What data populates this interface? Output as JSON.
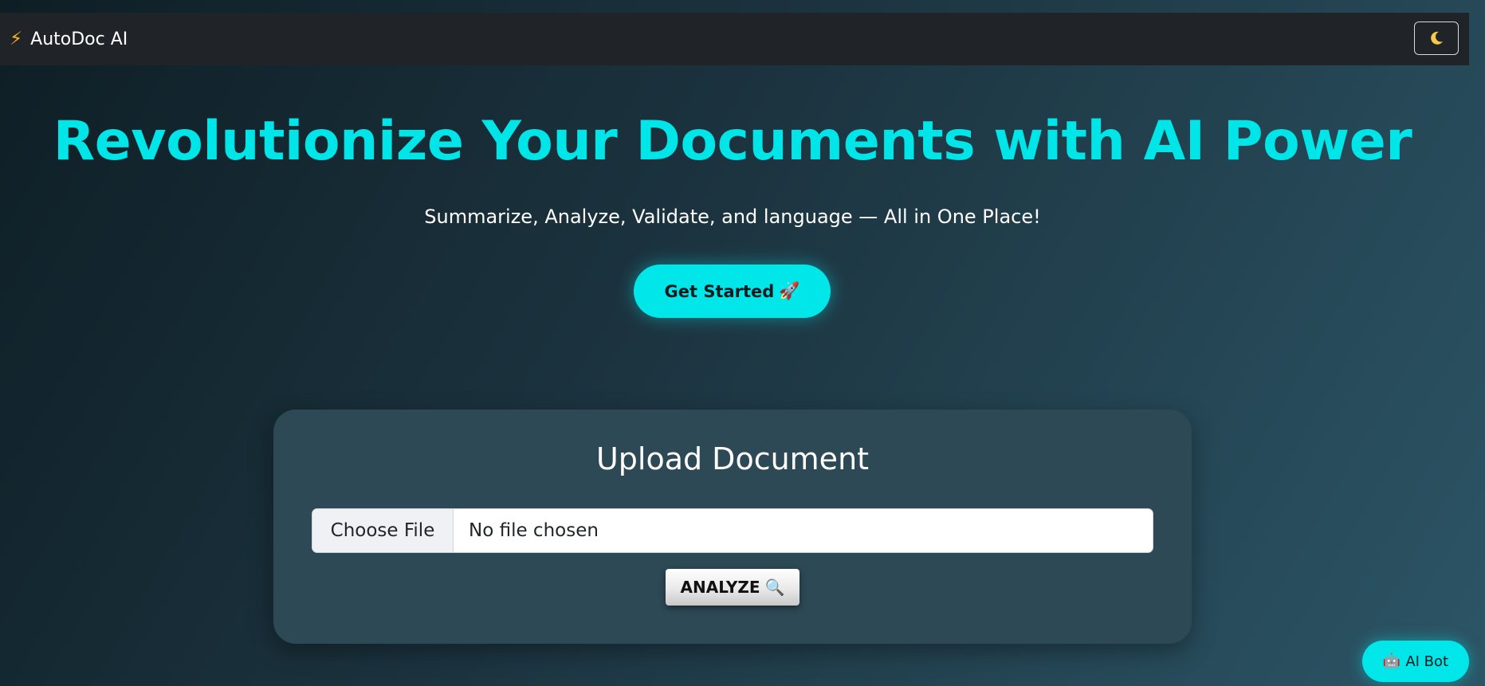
{
  "navbar": {
    "brand_icon": "lightning-icon",
    "brand_name": "AutoDoc AI",
    "theme_toggle_icon": "moon-icon"
  },
  "hero": {
    "title": "Revolutionize Your Documents with AI Power",
    "subtitle": "Summarize, Analyze, Validate, and language — All in One Place!",
    "cta_label": "Get Started",
    "cta_icon": "rocket-icon"
  },
  "upload": {
    "title": "Upload Document",
    "choose_file_label": "Choose File",
    "file_status": "No file chosen",
    "analyze_label": "ANALYZE",
    "analyze_icon": "magnifier-icon"
  },
  "chatbot": {
    "icon": "robot-icon",
    "label": "AI Bot"
  },
  "colors": {
    "accent": "#00e5e8",
    "navbar_bg": "#202328",
    "card_bg": "#2d4955"
  }
}
